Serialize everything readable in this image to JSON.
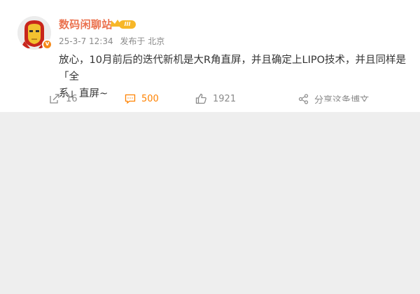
{
  "post": {
    "username": "数码闲聊站",
    "level_badge": "III",
    "verify_mark": "v",
    "timestamp": "25-3-7 12:34",
    "source": "发布于 北京",
    "text_line1": "放心，10月前后的迭代新机是大R角直屏，并且确定上LIPO技术，并且同样是「全",
    "text_line2": "系」直屏~"
  },
  "actions": {
    "repost_count": "16",
    "comment_count": "500",
    "like_count": "1921",
    "share_label": "分享这条博文"
  },
  "colors": {
    "username": "#eb7350",
    "comment_accent": "#ff8200",
    "verify_badge": "#f58a1b",
    "level_badge": "#f7b728",
    "page_background": "#eeeeee"
  },
  "icons": {
    "avatar": "iron-man-avatar",
    "repost": "repost-icon",
    "comment": "comment-icon",
    "like": "thumbs-up-icon",
    "share": "share-icon",
    "crown": "crown-icon"
  }
}
